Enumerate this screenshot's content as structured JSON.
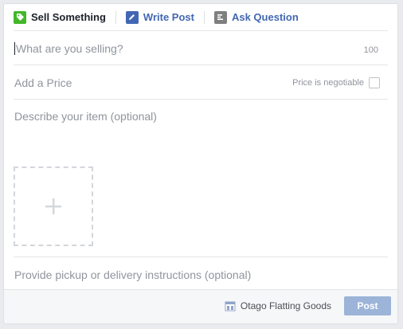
{
  "tabs": [
    {
      "label": "Sell Something",
      "icon": "tag-icon",
      "active": true
    },
    {
      "label": "Write Post",
      "icon": "pencil-icon"
    },
    {
      "label": "Ask Question",
      "icon": "poll-icon"
    }
  ],
  "form": {
    "title_placeholder": "What are you selling?",
    "title_char_limit": "100",
    "price_placeholder": "Add a Price",
    "negotiable_label": "Price is negotiable",
    "description_placeholder": "Describe your item (optional)",
    "pickup_placeholder": "Provide pickup or delivery instructions (optional)"
  },
  "footer": {
    "page_name": "Otago Flatting Goods",
    "post_label": "Post"
  },
  "colors": {
    "tag_green": "#42b72a",
    "pencil_blue": "#4267b2",
    "poll_gray": "#7f7f7f",
    "post_button": "#9cb4d8",
    "footer_bg": "#f6f7f9"
  }
}
